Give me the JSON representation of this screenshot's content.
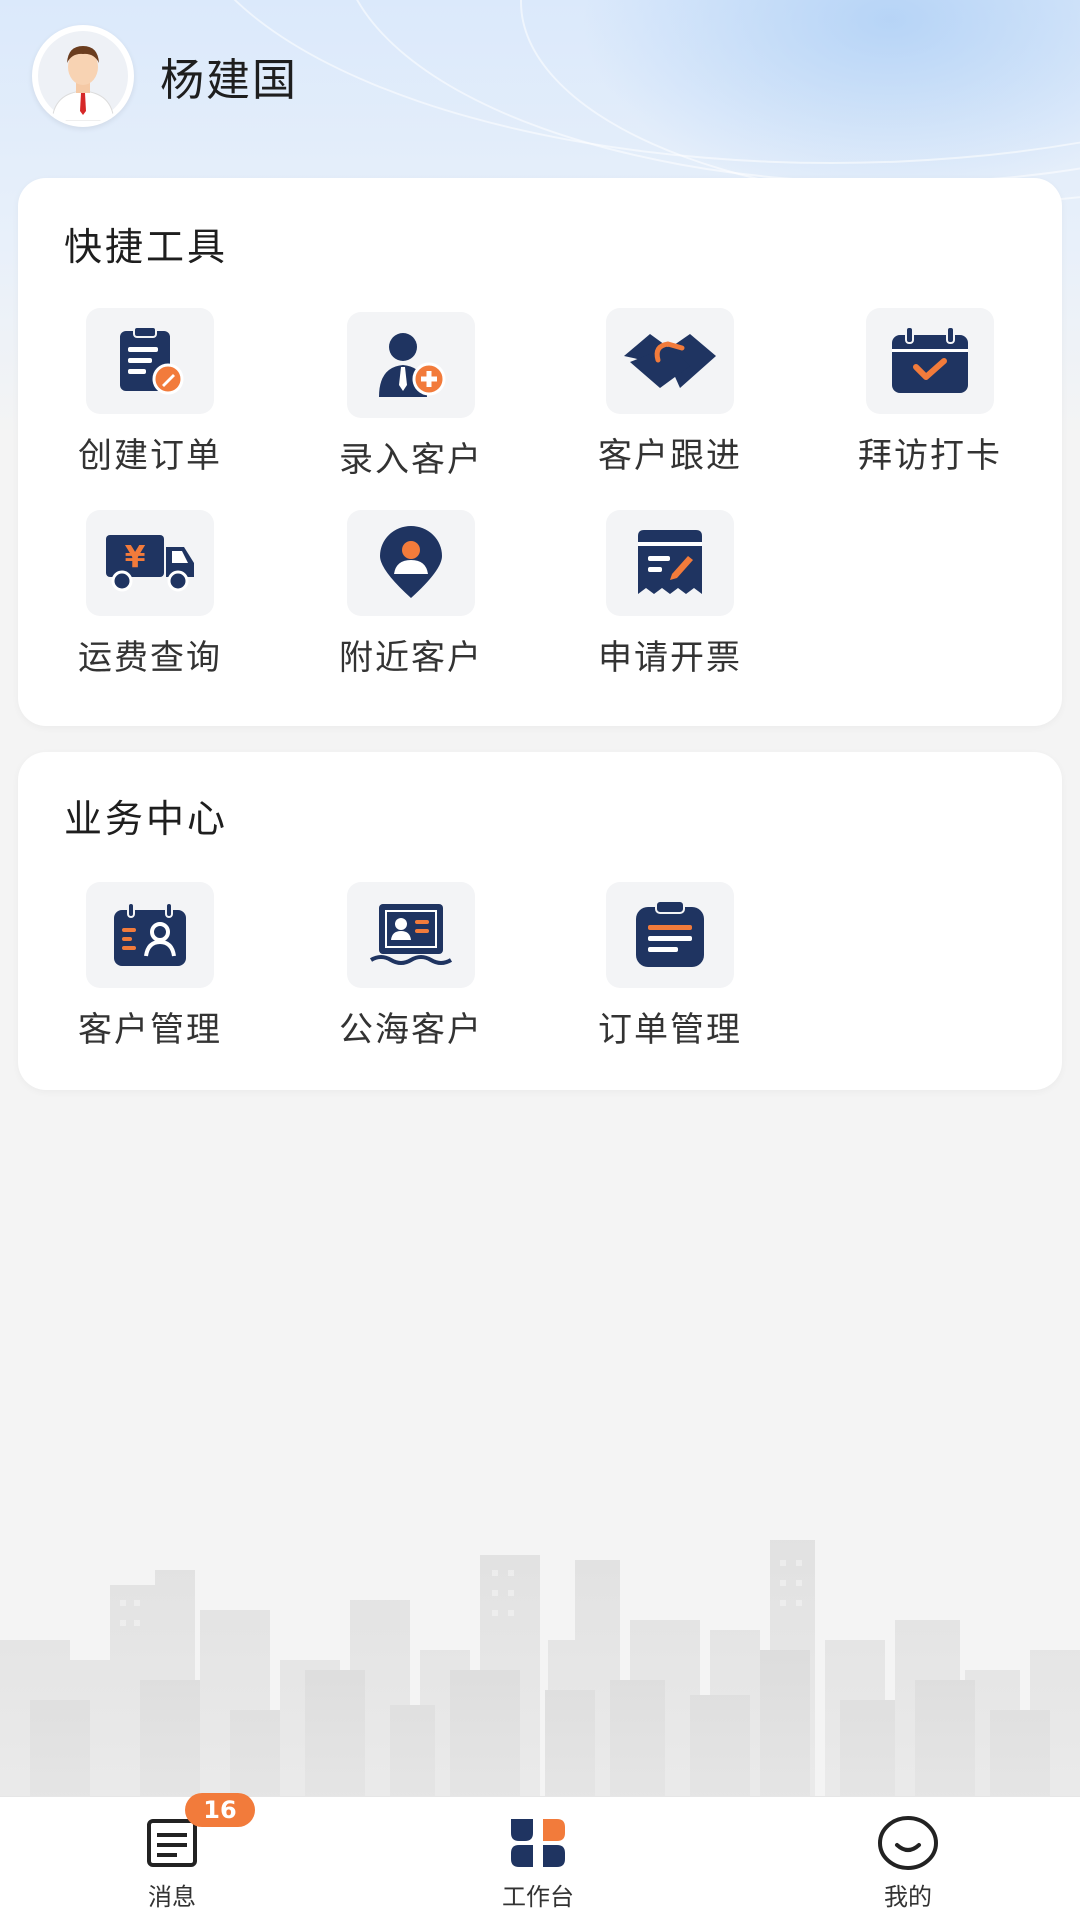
{
  "user": {
    "name": "杨建国",
    "avatar_icon": "user-avatar-icon"
  },
  "quick_tools": {
    "title": "快捷工具",
    "items": [
      {
        "label": "创建订单",
        "icon": "create-order-icon"
      },
      {
        "label": "录入客户",
        "icon": "add-customer-icon"
      },
      {
        "label": "客户跟进",
        "icon": "handshake-icon"
      },
      {
        "label": "拜访打卡",
        "icon": "calendar-check-icon"
      },
      {
        "label": "运费查询",
        "icon": "freight-truck-icon"
      },
      {
        "label": "附近客户",
        "icon": "location-pin-icon"
      },
      {
        "label": "申请开票",
        "icon": "invoice-icon"
      }
    ]
  },
  "business_center": {
    "title": "业务中心",
    "items": [
      {
        "label": "客户管理",
        "icon": "customer-card-icon"
      },
      {
        "label": "公海客户",
        "icon": "sea-customer-icon"
      },
      {
        "label": "订单管理",
        "icon": "order-clipboard-icon"
      }
    ]
  },
  "tabbar": {
    "items": [
      {
        "label": "消息",
        "icon": "message-icon",
        "badge": "16"
      },
      {
        "label": "工作台",
        "icon": "workbench-icon"
      },
      {
        "label": "我的",
        "icon": "smile-icon"
      }
    ]
  },
  "colors": {
    "icon_navy": "#1f3461",
    "icon_orange": "#f27b3b",
    "badge": "#f27b3b"
  }
}
